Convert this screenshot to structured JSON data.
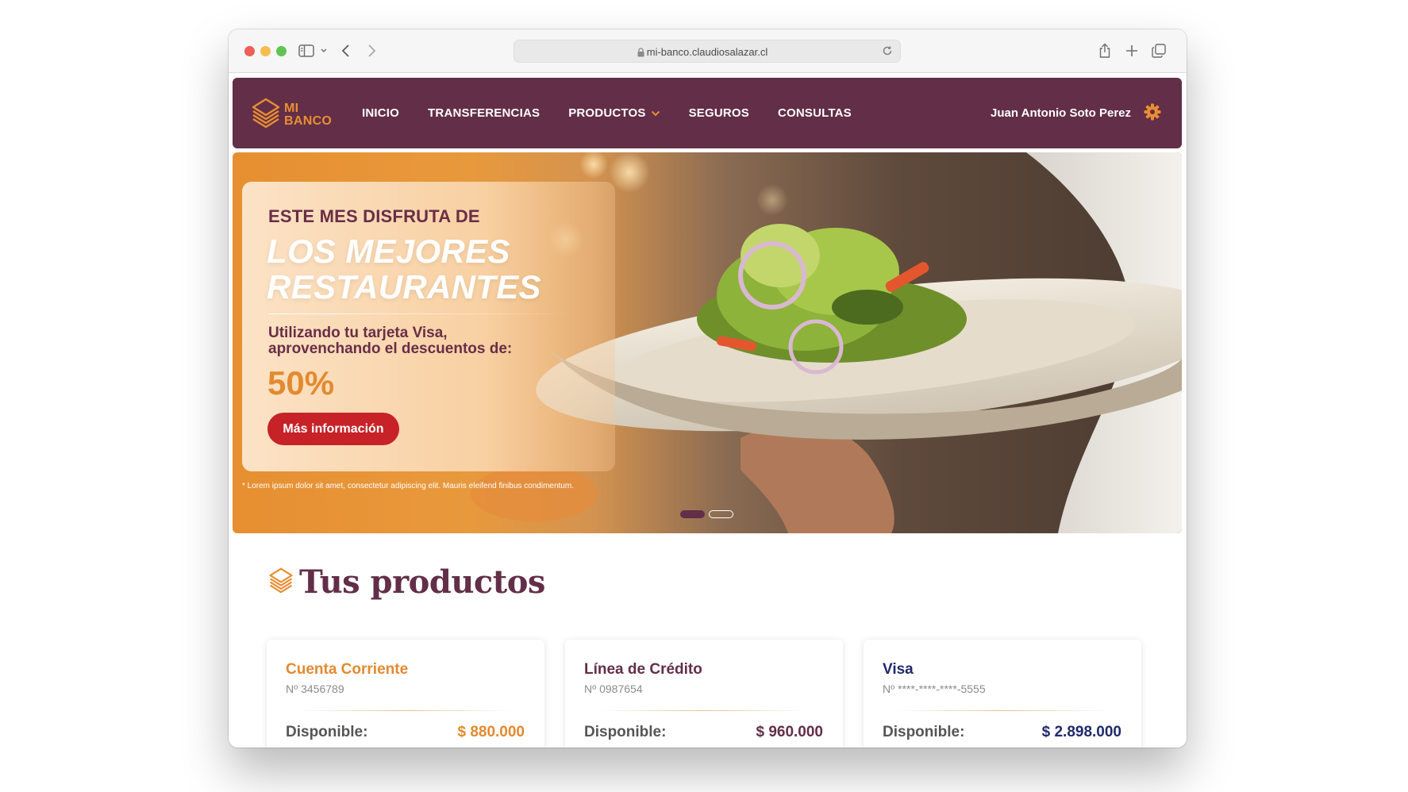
{
  "browser": {
    "url": "mi-banco.claudiosalazar.cl"
  },
  "brand": {
    "logo_line1": "MI",
    "logo_line2": "BANCO",
    "primary_color": "#632e47",
    "accent_color": "#e98e33"
  },
  "nav": {
    "items": [
      {
        "label": "INICIO"
      },
      {
        "label": "TRANSFERENCIAS"
      },
      {
        "label": "PRODUCTOS"
      },
      {
        "label": "SEGUROS"
      },
      {
        "label": "CONSULTAS"
      }
    ],
    "user_name": "Juan Antonio Soto Perez"
  },
  "hero": {
    "kicker": "ESTE MES DISFRUTA DE",
    "headline_line1": "LOS MEJORES",
    "headline_line2": "RESTAURANTES",
    "subtext": "Utilizando tu tarjeta Visa, aprovenchando el descuentos de:",
    "discount": "50%",
    "cta": "Más información",
    "disclaimer": "* Lorem ipsum dolor sit amet, consectetur adipiscing elit. Mauris eleifend finibus condimentum.",
    "slide_count": 2,
    "active_slide": 1
  },
  "products": {
    "title": "Tus productos",
    "cards": [
      {
        "name": "Cuenta Corriente",
        "number": "Nº 3456789",
        "label": "Disponible:",
        "amount": "$ 880.000",
        "color": "#e38a2f"
      },
      {
        "name": "Línea de Crédito",
        "number": "Nº 0987654",
        "label": "Disponible:",
        "amount": "$ 960.000",
        "color": "#632e47"
      },
      {
        "name": "Visa",
        "number": "Nº ****-****-****-5555",
        "label": "Disponible:",
        "amount": "$ 2.898.000",
        "color": "#1f2a6b"
      }
    ]
  }
}
